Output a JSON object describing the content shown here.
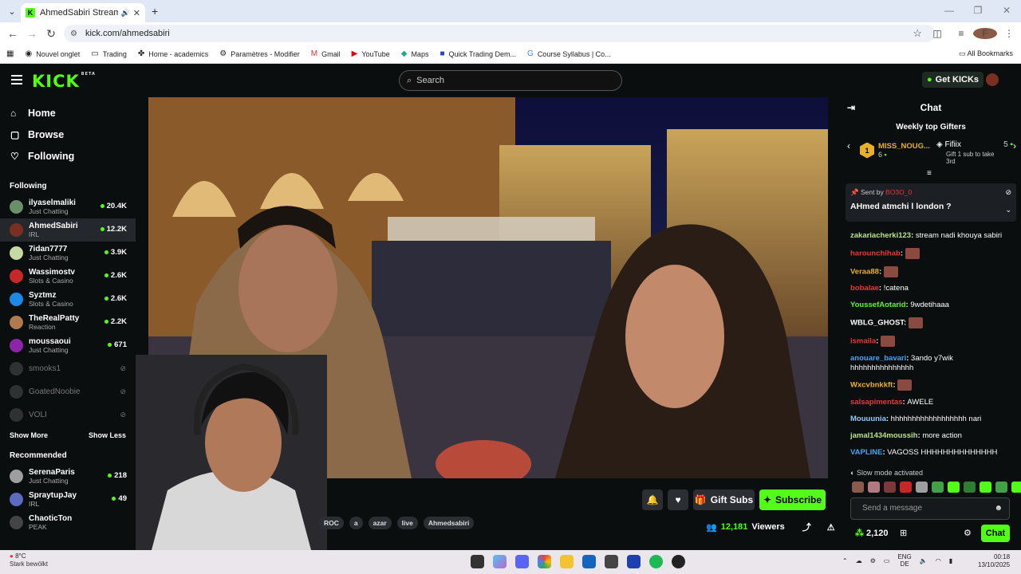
{
  "browser": {
    "tab_title": "AhmedSabiri Stream - Wat",
    "url": "kick.com/ahmedsabiri",
    "bookmarks": [
      "Nouvel onglet",
      "Trading",
      "Home - academics",
      "Paramètres - Modifier",
      "Gmail",
      "YouTube",
      "Maps",
      "Quick Trading Dem...",
      "Course Syllabus | Co..."
    ],
    "all_bookmarks": "All Bookmarks"
  },
  "header": {
    "logo": "KICK",
    "logo_badge": "BETA",
    "search_placeholder": "Search",
    "get_kicks": "Get KICKs"
  },
  "sidebar": {
    "nav": [
      {
        "label": "Home",
        "icon": "home-icon"
      },
      {
        "label": "Browse",
        "icon": "browse-icon"
      },
      {
        "label": "Following",
        "icon": "heart-icon"
      }
    ],
    "following_title": "Following",
    "following": [
      {
        "name": "ilyaselmaliki",
        "category": "Just Chatting",
        "viewers": "20.4K",
        "color": "#6b8f6b"
      },
      {
        "name": "AhmedSabiri",
        "category": "IRL",
        "viewers": "12.2K",
        "color": "#7a3020"
      },
      {
        "name": "7idan7777",
        "category": "Just Chatting",
        "viewers": "3.9K",
        "color": "#c7d9a3"
      },
      {
        "name": "Wassimostv",
        "category": "Slots & Casino",
        "viewers": "2.6K",
        "color": "#c62828"
      },
      {
        "name": "Syztmz",
        "category": "Slots & Casino",
        "viewers": "2.6K",
        "color": "#1e88e5"
      },
      {
        "name": "TheRealPatty",
        "category": "Reaction",
        "viewers": "2.2K",
        "color": "#b07a50"
      },
      {
        "name": "moussaoui",
        "category": "Just Chatting",
        "viewers": "671",
        "color": "#8e24aa"
      }
    ],
    "offline": [
      "smooks1",
      "GoatedNoobie",
      "VOLI"
    ],
    "show_more": "Show More",
    "show_less": "Show Less",
    "recommended_title": "Recommended",
    "recommended": [
      {
        "name": "SerenaParis",
        "category": "Just Chatting",
        "viewers": "218",
        "color": "#9e9e9e"
      },
      {
        "name": "SpraytupJay",
        "category": "IRL",
        "viewers": "49",
        "color": "#5c6bc0"
      },
      {
        "name": "ChaoticTon",
        "category": "PEAK",
        "viewers": "",
        "color": "#444"
      }
    ]
  },
  "stream": {
    "tags": [
      "ROC",
      "a",
      "azar",
      "live",
      "Ahmedsabiri"
    ],
    "gift_subs": "Gift Subs",
    "subscribe": "Subscribe",
    "viewers": "12,181",
    "viewers_label": "Viewers"
  },
  "chat": {
    "title": "Chat",
    "gifters_title": "Weekly top Gifters",
    "top_gifter": {
      "rank": "1",
      "name": "MISS_NOUG...",
      "count": "6"
    },
    "second_gifter": {
      "name": "Fifiix",
      "count": "5",
      "note1": "Gift 1 sub to take",
      "note2": "3rd"
    },
    "pinned": {
      "sent_by": "Sent by",
      "user": "BO3O_0",
      "message": "AHmed atmchi l london ?"
    },
    "messages": [
      {
        "user": "zakariacherki123",
        "color": "#b7e38a",
        "text": "stream nadi khouya sabiri",
        "emote": false
      },
      {
        "user": "harounchihab",
        "color": "#e53935",
        "text": "",
        "emote": true
      },
      {
        "user": "Veraa88",
        "color": "#e8b02a",
        "text": "",
        "emote": true
      },
      {
        "user": "bobalae",
        "color": "#e53935",
        "text": "!catena",
        "emote": false
      },
      {
        "user": "YoussefAotarid",
        "color": "#53fc18",
        "text": "9wdetihaaa",
        "emote": false
      },
      {
        "user": "WBLG_GHOST",
        "color": "#ffffff",
        "text": "",
        "emote": true
      },
      {
        "user": "ismaila",
        "color": "#e53935",
        "text": "",
        "emote": true
      },
      {
        "user": "anouare_bavari",
        "color": "#42a5f5",
        "text": "3ando y7wik hhhhhhhhhhhhhhh",
        "emote": false
      },
      {
        "user": "Wxcvbnkkft",
        "color": "#e8b02a",
        "text": "",
        "emote": true
      },
      {
        "user": "salsapimentas",
        "color": "#e53935",
        "text": "AWELE",
        "emote": false
      },
      {
        "user": "Mouuunia",
        "color": "#90caf9",
        "text": "hhhhhhhhhhhhhhhhhh nari",
        "emote": false
      },
      {
        "user": "jamal1434moussih",
        "color": "#b7e38a",
        "text": "more action",
        "emote": false
      },
      {
        "user": "VAPLINE",
        "color": "#42a5f5",
        "text": "VAGOSS HHHHHHHHHHHHHH",
        "emote": false
      }
    ],
    "slow_mode": "Slow mode activated",
    "input_placeholder": "Send a message",
    "points": "2,120",
    "chat_button": "Chat"
  },
  "taskbar": {
    "temperature": "8°C",
    "weather": "Stark bewölkt",
    "lang": "ENG",
    "region": "DE",
    "time": "00:18",
    "date": "13/10/2025"
  }
}
